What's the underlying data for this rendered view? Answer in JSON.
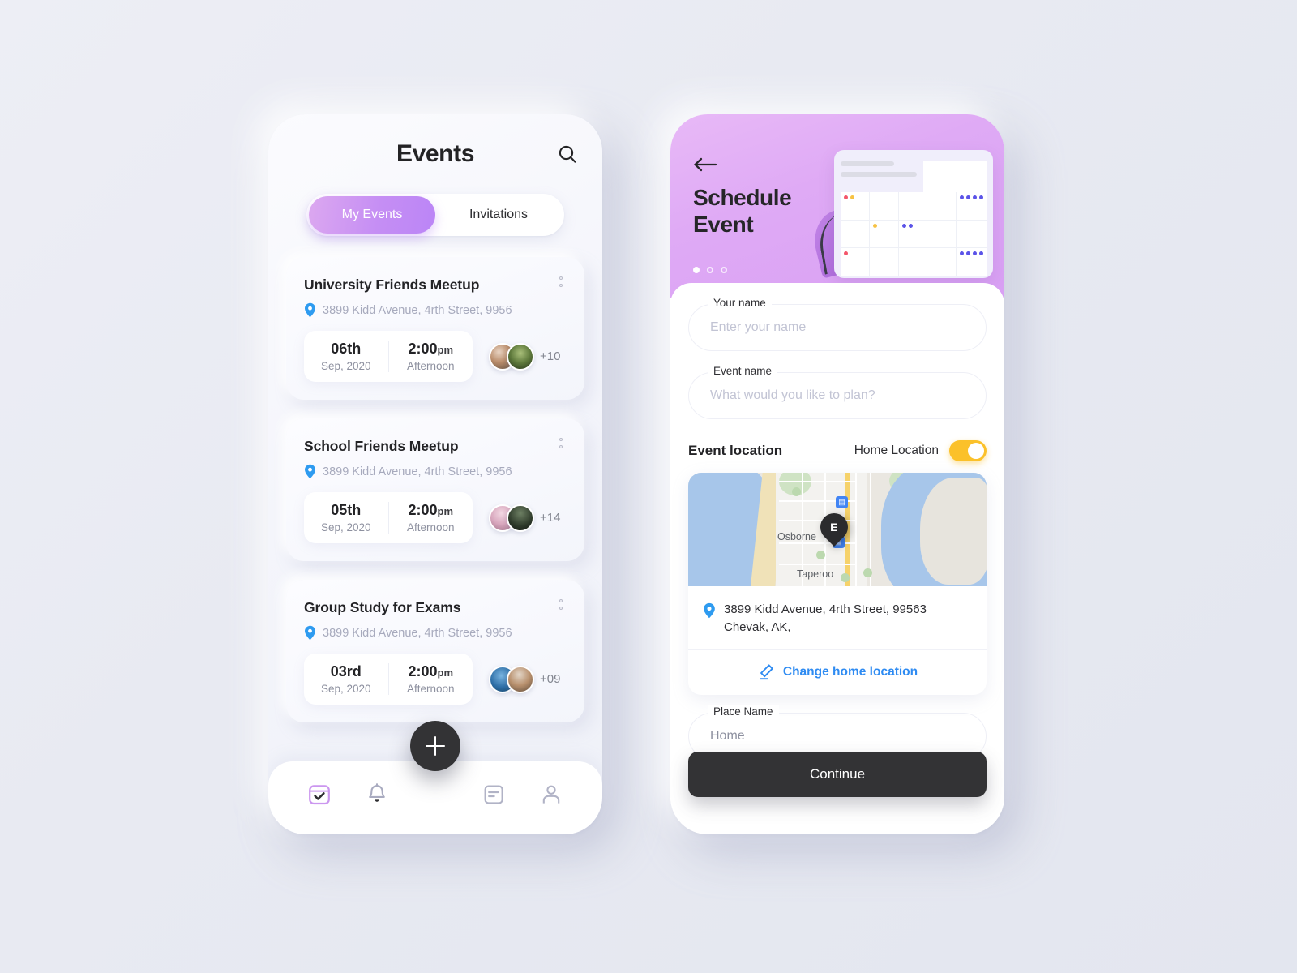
{
  "theme": {
    "background": "#e8eaf2",
    "accent_purple": "#bb85f6",
    "accent_pink": "#dca8f0",
    "accent_yellow": "#fbc12a",
    "accent_blue": "#2e8bf2",
    "dark": "#333335",
    "pin_blue": "#2e8bf2"
  },
  "events_screen": {
    "title": "Events",
    "search_icon": "search-icon",
    "tabs": [
      {
        "label": "My Events",
        "active": true
      },
      {
        "label": "Invitations",
        "active": false
      }
    ],
    "cards": [
      {
        "title": "University Friends Meetup",
        "address": "3899 Kidd Avenue, 4rth Street, 9956",
        "day": "06th",
        "month_year": "Sep, 2020",
        "time": "2:00",
        "time_suffix": "pm",
        "period": "Afternoon",
        "more_count": "+10",
        "menu_icon": "kebab-menu-icon"
      },
      {
        "title": "School Friends Meetup",
        "address": "3899 Kidd Avenue, 4rth Street, 9956",
        "day": "05th",
        "month_year": "Sep, 2020",
        "time": "2:00",
        "time_suffix": "pm",
        "period": "Afternoon",
        "more_count": "+14",
        "menu_icon": "kebab-menu-icon"
      },
      {
        "title": "Group Study for Exams",
        "address": "3899 Kidd Avenue, 4rth Street, 9956",
        "day": "03rd",
        "month_year": "Sep, 2020",
        "time": "2:00",
        "time_suffix": "pm",
        "period": "Afternoon",
        "more_count": "+09",
        "menu_icon": "kebab-menu-icon"
      }
    ],
    "fab": {
      "icon": "plus-icon",
      "label": "Add event"
    },
    "bottom_nav": [
      {
        "icon": "calendar-check-icon",
        "active": true
      },
      {
        "icon": "bell-icon",
        "active": false
      },
      {
        "icon": "note-list-icon",
        "active": false
      },
      {
        "icon": "user-profile-icon",
        "active": false
      }
    ]
  },
  "schedule_screen": {
    "back_icon": "arrow-left-icon",
    "title_line1": "Schedule",
    "title_line2": "Event",
    "pager_dots": 3,
    "pager_active_index": 0,
    "illustration": {
      "name": "calendar-illustration",
      "event_dots": [
        {
          "cell": 0,
          "colors": [
            "red",
            "yellow"
          ]
        },
        {
          "cell": 4,
          "colors": [
            "blue",
            "blue",
            "blue",
            "blue"
          ]
        },
        {
          "cell": 6,
          "colors": [
            "yellow"
          ]
        },
        {
          "cell": 7,
          "colors": [
            "blue",
            "blue"
          ]
        },
        {
          "cell": 10,
          "colors": [
            "red"
          ]
        },
        {
          "cell": 14,
          "colors": [
            "blue",
            "blue",
            "blue",
            "blue"
          ]
        }
      ]
    },
    "fields": {
      "your_name": {
        "label": "Your name",
        "placeholder": "Enter your name",
        "value": ""
      },
      "event_name": {
        "label": "Event name",
        "placeholder": "What would you like to plan?",
        "value": ""
      },
      "place_name": {
        "label": "Place Name",
        "placeholder": "Home",
        "value": "Home"
      }
    },
    "event_location": {
      "section_title": "Event location",
      "toggle_label": "Home Location",
      "toggle_on": true,
      "map": {
        "labels": [
          "Osborne",
          "Taperoo"
        ],
        "pin_letter": "E"
      },
      "address_line1": "3899 Kidd Avenue, 4rth Street, 99563",
      "address_line2": "Chevak, AK,",
      "change_link": "Change home location",
      "change_icon": "pencil-edit-icon",
      "address_icon": "location-pin-icon"
    },
    "continue_button": "Continue"
  }
}
